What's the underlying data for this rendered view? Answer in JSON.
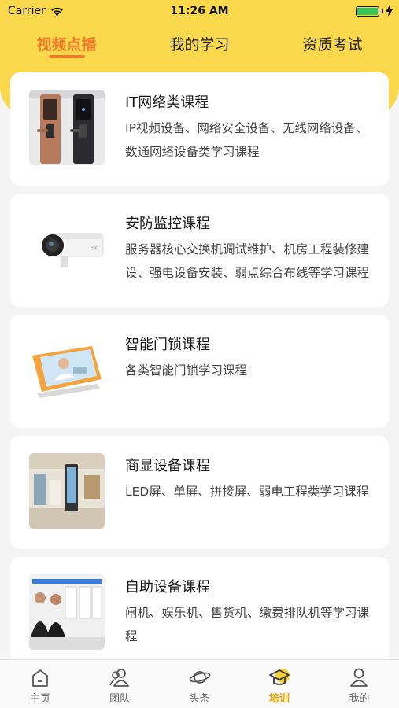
{
  "status": {
    "carrier": "Carrier",
    "time": "11:26 AM",
    "battery_level": 1.0
  },
  "top_tabs": [
    {
      "label": "视频点播",
      "active": true
    },
    {
      "label": "我的学习",
      "active": false
    },
    {
      "label": "资质考试",
      "active": false
    }
  ],
  "courses": [
    {
      "title": "IT网络类课程",
      "desc": "IP视频设备、网络安全设备、无线网络设备、数通网络设备类学习课程",
      "image": "smart-lock-photo"
    },
    {
      "title": "安防监控课程",
      "desc": "服务器核心交换机调试维护、机房工程装修建设、强电设备安装、弱点综合布线等学习课程",
      "image": "security-camera-photo"
    },
    {
      "title": "智能门锁课程",
      "desc": "各类智能门锁学习课程",
      "image": "online-class-photo"
    },
    {
      "title": "商显设备课程",
      "desc": "LED屏、单屏、拼接屏、弱电工程类学习课程",
      "image": "display-screens-photo"
    },
    {
      "title": "自助设备课程",
      "desc": "闸机、娱乐机、售货机、缴费排队机等学习课程",
      "image": "kiosk-team-photo"
    }
  ],
  "bottom_nav": [
    {
      "label": "主页",
      "icon": "home-icon",
      "active": false
    },
    {
      "label": "团队",
      "icon": "team-icon",
      "active": false
    },
    {
      "label": "头条",
      "icon": "planet-icon",
      "active": false
    },
    {
      "label": "培训",
      "icon": "graduation-cap-icon",
      "active": true
    },
    {
      "label": "我的",
      "icon": "user-icon",
      "active": false
    }
  ],
  "colors": {
    "header_yellow": "#fad84c",
    "accent_orange": "#f07a2a",
    "nav_active": "#f0a400"
  }
}
